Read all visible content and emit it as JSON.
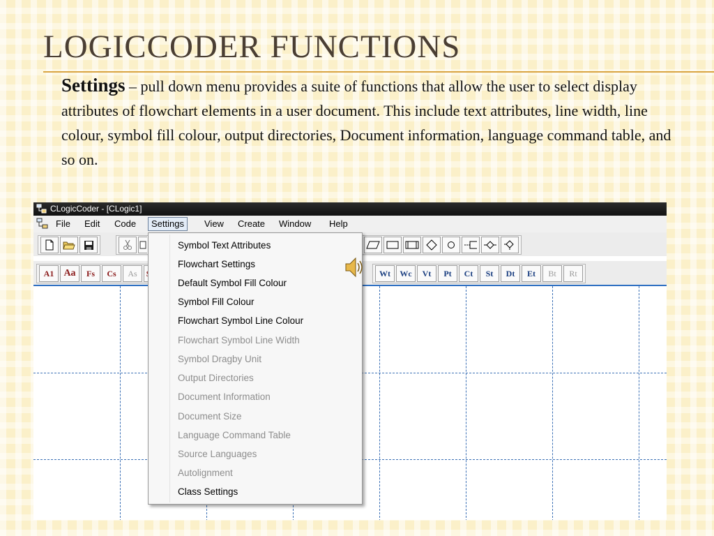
{
  "slide": {
    "title": "LogicCoder Functions",
    "keyword": "Settings",
    "description": " – pull down menu provides a suite of functions that allow the user to select display attributes of flowchart elements in a user document. This include text attributes, line width, line colour, symbol fill colour, output directories, Document information, language command table,  and so on."
  },
  "window": {
    "title": "CLogicCoder - [CLogic1]"
  },
  "menubar": {
    "items": [
      "File",
      "Edit",
      "Code",
      "Settings",
      "View",
      "Create",
      "Window",
      "Help"
    ],
    "active": "Settings"
  },
  "toolbar_text_buttons": {
    "left": [
      "A1",
      "Aa",
      "Fs",
      "Cs",
      "As",
      "S"
    ],
    "right": [
      "Wt",
      "Wc",
      "Vt",
      "Pt",
      "Ct",
      "St",
      "Dt",
      "Et",
      "Bt",
      "Rt"
    ]
  },
  "settings_menu": {
    "items": [
      {
        "label": "Symbol Text Attributes",
        "enabled": true
      },
      {
        "label": "Flowchart Settings",
        "enabled": true
      },
      {
        "label": "Default Symbol Fill Colour",
        "enabled": true
      },
      {
        "label": "Symbol Fill Colour",
        "enabled": true
      },
      {
        "label": "Flowchart Symbol Line Colour",
        "enabled": true
      },
      {
        "label": "Flowchart Symbol Line Width",
        "enabled": false
      },
      {
        "label": "Symbol Dragby Unit",
        "enabled": false
      },
      {
        "label": "Output Directories",
        "enabled": false
      },
      {
        "label": "Document Information",
        "enabled": false
      },
      {
        "label": "Document Size",
        "enabled": false
      },
      {
        "label": "Language Command Table",
        "enabled": false
      },
      {
        "label": "Source Languages",
        "enabled": false
      },
      {
        "label": "Autolignment",
        "enabled": false
      },
      {
        "label": "Class Settings",
        "enabled": true
      }
    ]
  },
  "icons": {
    "app": "flowchart-app-icon",
    "speaker": "speaker-icon"
  },
  "colors": {
    "title_text": "#4a3e33",
    "accent_rule": "#d9a441",
    "grid": "#3a6fb5"
  }
}
